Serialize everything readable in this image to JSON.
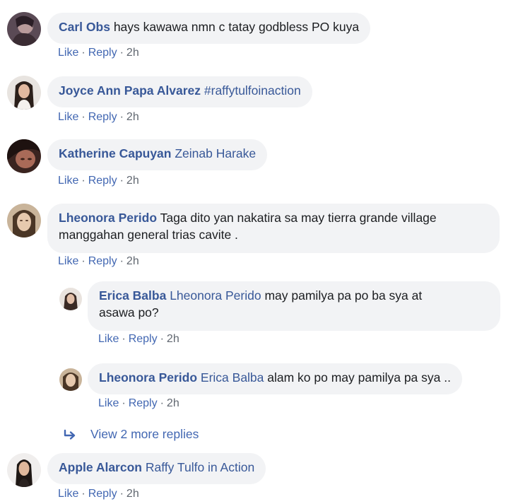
{
  "comments": [
    {
      "author": "Carl Obs",
      "text": " hays kawawa nmn c tatay godbless PO kuya",
      "mention": "",
      "line2": "",
      "actions": {
        "like": "Like",
        "reply": "Reply",
        "time": "2h",
        "sep": "·"
      }
    },
    {
      "author": "Joyce Ann Papa Alvarez",
      "text": "",
      "mention": " #raffytulfoinaction",
      "line2": "",
      "actions": {
        "like": "Like",
        "reply": "Reply",
        "time": "2h",
        "sep": "·"
      }
    },
    {
      "author": "Katherine Capuyan",
      "text": "",
      "mention": " Zeinab Harake",
      "line2": "",
      "actions": {
        "like": "Like",
        "reply": "Reply",
        "time": "2h",
        "sep": "·"
      }
    },
    {
      "author": "Lheonora Perido",
      "text": " Taga dito yan nakatira sa may tierra grande village",
      "mention": "",
      "line2": "manggahan general trias cavite .",
      "actions": {
        "like": "Like",
        "reply": "Reply",
        "time": "2h",
        "sep": "·"
      }
    },
    {
      "author": "Apple Alarcon",
      "text": "",
      "mention": " Raffy Tulfo in Action",
      "line2": "",
      "actions": {
        "like": "Like",
        "reply": "Reply",
        "time": "2h",
        "sep": "·"
      }
    }
  ],
  "replies": [
    {
      "author": "Erica Balba",
      "mention": " Lheonora Perido",
      "text": " may pamilya pa po ba sya at",
      "line2": "asawa po?",
      "actions": {
        "like": "Like",
        "reply": "Reply",
        "time": "2h",
        "sep": "·"
      }
    },
    {
      "author": "Lheonora Perido",
      "mention": " Erica Balba",
      "text": " alam ko po may pamilya pa sya ..",
      "line2": "",
      "actions": {
        "like": "Like",
        "reply": "Reply",
        "time": "2h",
        "sep": "·"
      }
    }
  ],
  "view_more": {
    "label": "View 2 more replies",
    "icon": "reply-arrow-icon"
  },
  "colors": {
    "name": "#385898",
    "link": "#4267b2",
    "bubble": "#f2f3f5",
    "meta": "#606770"
  }
}
